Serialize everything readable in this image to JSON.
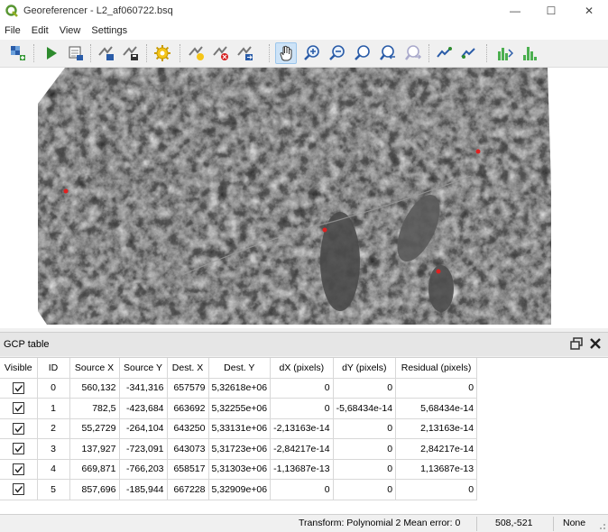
{
  "window": {
    "title": "Georeferencer - L2_af060722.bsq",
    "minimize_glyph": "—",
    "maximize_glyph": "☐",
    "close_glyph": "✕"
  },
  "menu": [
    "File",
    "Edit",
    "View",
    "Settings"
  ],
  "toolbar": {
    "buttons": [
      "open-raster-icon",
      "start-georeferencing-icon",
      "generate-gdal-script-icon",
      "load-gcp-points-icon",
      "save-gcp-points-icon",
      "transformation-settings-icon",
      "add-point-icon",
      "delete-point-icon",
      "move-gcp-point-icon",
      "pan-icon",
      "zoom-in-icon",
      "zoom-out-icon",
      "zoom-to-layer-icon",
      "zoom-last-icon",
      "zoom-next-icon",
      "link-georeferencer-icon",
      "link-qgis-icon",
      "full-histogram-stretch-icon",
      "local-histogram-stretch-icon"
    ],
    "active": "pan-icon"
  },
  "gcp_panel": {
    "title": "GCP table",
    "columns": [
      "Visible",
      "ID",
      "Source X",
      "Source Y",
      "Dest. X",
      "Dest. Y",
      "dX (pixels)",
      "dY (pixels)",
      "Residual (pixels)"
    ],
    "rows": [
      {
        "visible": true,
        "id": "0",
        "source_x": "560,132",
        "source_y": "-341,316",
        "dest_x": "657579",
        "dest_y": "5,32618e+06",
        "dx": "0",
        "dy": "0",
        "residual": "0"
      },
      {
        "visible": true,
        "id": "1",
        "source_x": "782,5",
        "source_y": "-423,684",
        "dest_x": "663692",
        "dest_y": "5,32255e+06",
        "dx": "0",
        "dy": "-5,68434e-14",
        "residual": "5,68434e-14"
      },
      {
        "visible": true,
        "id": "2",
        "source_x": "55,2729",
        "source_y": "-264,104",
        "dest_x": "643250",
        "dest_y": "5,33131e+06",
        "dx": "-2,13163e-14",
        "dy": "0",
        "residual": "2,13163e-14"
      },
      {
        "visible": true,
        "id": "3",
        "source_x": "137,927",
        "source_y": "-723,091",
        "dest_x": "643073",
        "dest_y": "5,31723e+06",
        "dx": "-2,84217e-14",
        "dy": "0",
        "residual": "2,84217e-14"
      },
      {
        "visible": true,
        "id": "4",
        "source_x": "669,871",
        "source_y": "-766,203",
        "dest_x": "658517",
        "dest_y": "5,31303e+06",
        "dx": "-1,13687e-13",
        "dy": "0",
        "residual": "1,13687e-13"
      },
      {
        "visible": true,
        "id": "5",
        "source_x": "857,696",
        "source_y": "-185,944",
        "dest_x": "667228",
        "dest_y": "5,32909e+06",
        "dx": "0",
        "dy": "0",
        "residual": "0"
      }
    ]
  },
  "status": {
    "transform": "Transform: Polynomial 2 Mean error: 0",
    "coords": "508,-521",
    "crs": "None"
  },
  "colors": {
    "gcp_marker": "#e02020",
    "active_tool_bg": "#cde3f7"
  }
}
